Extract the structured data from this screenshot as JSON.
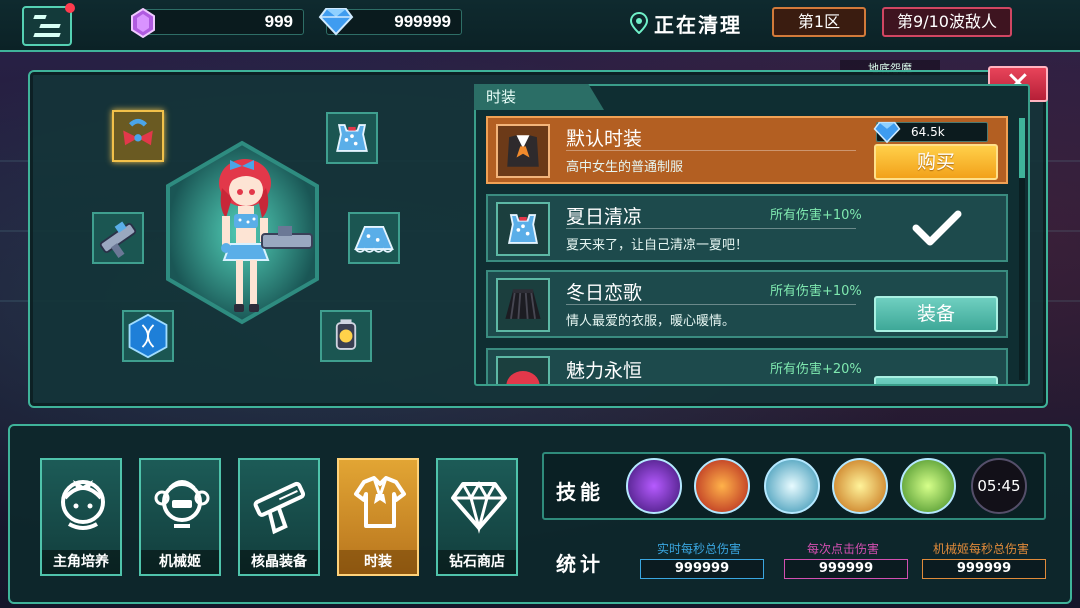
{
  "topbar": {
    "gems": "999",
    "diamonds": "999999",
    "status": "正在清理",
    "zone": "第1区",
    "wave": "第9/10波敌人",
    "boss_label": "地底怨魔"
  },
  "panel": {
    "list_title": "时装"
  },
  "outfits": [
    {
      "name": "默认时装",
      "desc": "高中女生的普通制服",
      "bonus": "",
      "price": "64.5k",
      "action": "购买",
      "state": "buy"
    },
    {
      "name": "夏日清凉",
      "desc": "夏天来了，让自己清凉一夏吧！",
      "bonus": "所有伤害+10%",
      "price": "",
      "action": "",
      "state": "equipped"
    },
    {
      "name": "冬日恋歌",
      "desc": "情人最爱的衣服，暖心暖情。",
      "bonus": "所有伤害+10%",
      "price": "",
      "action": "装备",
      "state": "equip"
    },
    {
      "name": "魅力永恒",
      "desc": "",
      "bonus": "所有伤害+20%",
      "price": "",
      "action": "",
      "state": "equip"
    }
  ],
  "nav": [
    {
      "label": "主角培养",
      "icon": "girl-head-icon"
    },
    {
      "label": "机械姬",
      "icon": "robot-girl-icon"
    },
    {
      "label": "核晶装备",
      "icon": "gun-icon"
    },
    {
      "label": "时装",
      "icon": "shirt-icon"
    },
    {
      "label": "钻石商店",
      "icon": "diamond-icon"
    }
  ],
  "skills": {
    "title": "技能",
    "icons": [
      "purple-hand-skill-icon",
      "fire-hand-skill-icon",
      "ice-spike-skill-icon",
      "golden-explosion-skill-icon",
      "green-claw-skill-icon"
    ],
    "timer": "05:45"
  },
  "stats": {
    "title": "统计",
    "items": [
      {
        "label": "实时每秒总伤害",
        "value": "999999",
        "color": "#3aa6e0"
      },
      {
        "label": "每次点击伤害",
        "value": "999999",
        "color": "#d34fb1"
      },
      {
        "label": "机械姬每秒总伤害",
        "value": "999999",
        "color": "#e08a3a"
      }
    ]
  },
  "colors": {
    "accent": "#3fb39a",
    "buy": "#f2a11a",
    "selected_row": "#b35f22",
    "close": "#e8445a"
  }
}
